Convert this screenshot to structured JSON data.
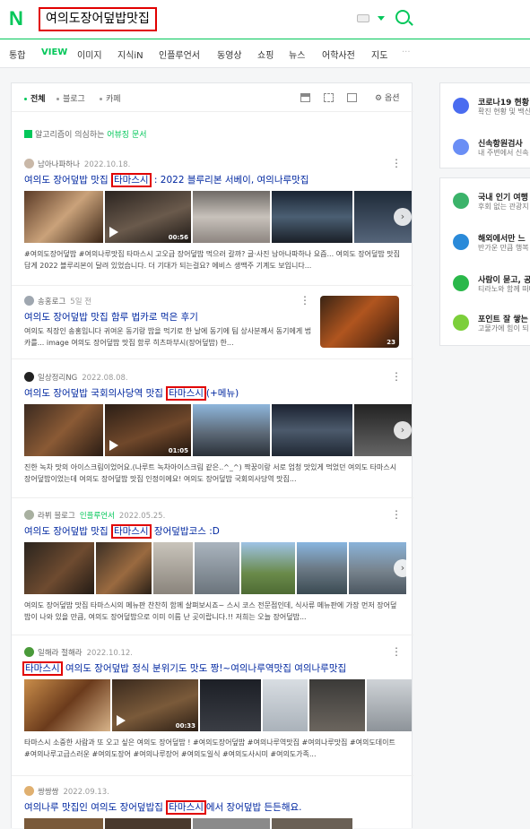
{
  "header": {
    "logo": "N",
    "query": "여의도장어덮밥맛집"
  },
  "tabs": [
    "통합",
    "VIEW",
    "이미지",
    "지식iN",
    "인플루언서",
    "동영상",
    "쇼핑",
    "뉴스",
    "어학사전",
    "지도",
    "···"
  ],
  "active_tab": "VIEW",
  "filters": {
    "all": "전체",
    "blog": "블로그",
    "cafe": "카페",
    "options": "옵션"
  },
  "notice": {
    "text": "알고리즘이 의심하는 ",
    "link": "어뷰징 문서"
  },
  "posts": [
    {
      "author": "남아나파하나",
      "date": "2022.10.18.",
      "pre": "여의도 장어덮밥 맛집 ",
      "hl": "타마스시",
      "post": " : 2022 블루리본 서베이, 여의나루맛집",
      "dur": "00:56",
      "desc": "#여의도장어덮밥 #여의나루맛집 타마스시 고오급 장어덮밥 먹으러 갈까? 글·사진 남아나파하나 요즘... 여의도 장어덮밥 맛집답게 2022 블루리본이 달려 있었습니다. 더 기대가 되는걸요? 에비스 생맥주 기계도 보입니다..."
    },
    {
      "author": "송홍로그",
      "date": "5일 전",
      "title": "여의도 장어덮밥 맛집 함루 법카로 먹은 후기",
      "count": "23",
      "desc": "여의도 직장인 송홍입니다 귀여운 동기랑 밥을 먹기로 한 날에 동기에 팀 상사분께서 동기에게 법카를... image 여의도 장어덮밥 맛집 함루 히츠마부시(장어덮밥) 한..."
    },
    {
      "author": "일상정리NG",
      "date": "2022.08.08.",
      "pre": "여의도 장어덮밥 국회의사당역 맛집 ",
      "hl": "타마스시",
      "post": "(+메뉴)",
      "dur": "01:05",
      "desc": "진한 녹차 맛의 아이스크림이었어요.(나루트 녹차아이스크림 같은..^_^) 짝꿍이랑 서로 엄청 맛있게 먹었던 여의도 타마스시 장어덮밥이었는데 여의도 장어덮밥 맛집 인정이에요! 여의도 장어덮밥 국회의사당역 맛집..."
    },
    {
      "author": "라뷔 블로그",
      "influencer": "인플루언서",
      "date": "2022.05.25.",
      "pre": "여의도 장어덮밥 맛집 ",
      "hl": "타마스시",
      "post": " 장어덮밥코스 :D",
      "desc": "여의도 장어덮밥 맛집 타마스시의 메뉴판 찬찬히 함께 살펴보시죠~ 스시 코스 전문점인데, 식사류 메뉴판에 가장 먼저 장어덮밥이 나와 있을 만큼, 여의도 장어덮밥으로 이미 이름 난 곳이랍니다.!! 저희는 오늘 장어덮밥..."
    },
    {
      "author": "일해라 절해라",
      "date": "2022.10.12.",
      "pre": "",
      "hl": "타마스시",
      "post": " 여의도 장어덮밥 정식 분위기도 맛도 짱!~여의나루역맛집 여의나루맛집",
      "dur": "00:33",
      "desc": "타마스시 소중한 사람과 또 오고 싶은 여의도 장어덮밥 ! #여의도장어덮밥 #여의나루역맛집 #여의나루맛집 #여의도데이트 #여의나루고급스러운 #여의도장어 #여의나루장어 #여의도일식 #여의도사시미 #여의도가족..."
    },
    {
      "author": "쌍쌍쌍",
      "date": "2022.09.13.",
      "pre": "여의나루 맛집인 여의도 장어덮밥집 ",
      "hl": "타마스시",
      "post": "에서 장어덮밥 든든해요."
    }
  ],
  "side": [
    {
      "title": "코로나19 현황",
      "sub": "확진 현황 및 백신",
      "color": "#4a6cf0"
    },
    {
      "title": "신속항원검사",
      "sub": "내 주변에서 신속",
      "color": "#6a8ef5"
    },
    {
      "title": "국내 인기 여행",
      "sub": "후회 없는 관광지",
      "color": "#3bb36a"
    },
    {
      "title": "해외에서만 느",
      "sub": "반가운 만큼 행복",
      "color": "#2a8ad9"
    },
    {
      "title": "사람이 묻고, 공",
      "sub": "티라노와 함께 떠나",
      "color": "#2ab84a"
    },
    {
      "title": "포인트 잘 쌓는",
      "sub": "고물가에 힘이 되",
      "color": "#7ccf3a"
    }
  ]
}
